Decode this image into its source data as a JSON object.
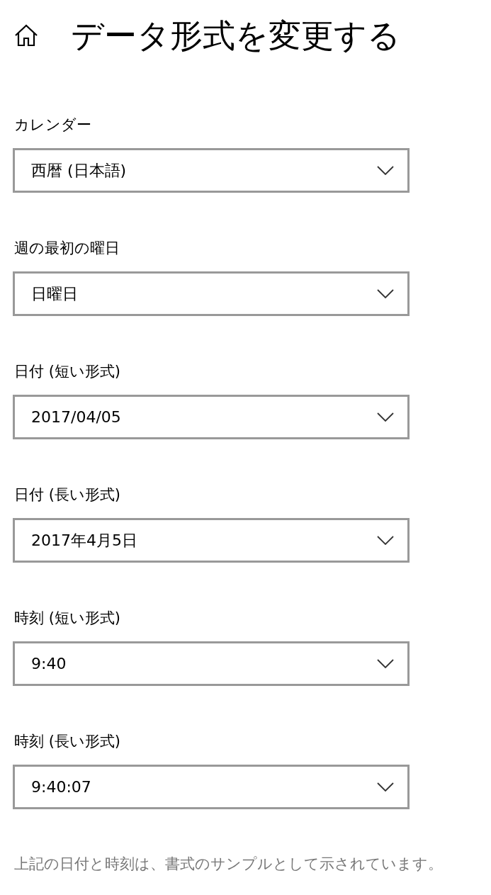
{
  "header": {
    "title": "データ形式を変更する"
  },
  "fields": [
    {
      "label": "カレンダー",
      "value": "西暦 (日本語)"
    },
    {
      "label": "週の最初の曜日",
      "value": "日曜日"
    },
    {
      "label": "日付 (短い形式)",
      "value": "2017/04/05"
    },
    {
      "label": "日付 (長い形式)",
      "value": "2017年4月5日"
    },
    {
      "label": "時刻 (短い形式)",
      "value": "9:40"
    },
    {
      "label": "時刻 (長い形式)",
      "value": "9:40:07"
    }
  ],
  "note": "上記の日付と時刻は、書式のサンプルとして示されています。"
}
